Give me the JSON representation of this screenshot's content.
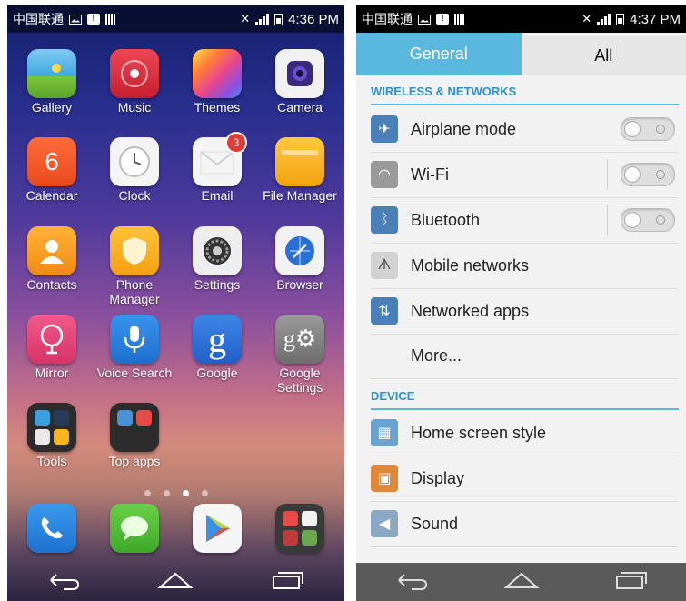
{
  "left": {
    "status": {
      "carrier": "中国联通",
      "time": "4:36 PM"
    },
    "apps": [
      {
        "label": "Gallery",
        "icon": "gallery-icon",
        "color": "#3fa7e0"
      },
      {
        "label": "Music",
        "icon": "music-icon",
        "color": "#d62b3a"
      },
      {
        "label": "Themes",
        "icon": "themes-icon",
        "color": "#e05ab0"
      },
      {
        "label": "Camera",
        "icon": "camera-icon",
        "color": "#f1f1f1"
      },
      {
        "label": "Calendar",
        "icon": "calendar-icon",
        "color": "#f05a28",
        "glyph": "6"
      },
      {
        "label": "Clock",
        "icon": "clock-icon",
        "color": "#f4f4f4"
      },
      {
        "label": "Email",
        "icon": "email-icon",
        "color": "#f4f4f4",
        "badge": "3"
      },
      {
        "label": "File Manager",
        "icon": "file-manager-icon",
        "color": "#f7b51e"
      },
      {
        "label": "Contacts",
        "icon": "contacts-icon",
        "color": "#f7a21e"
      },
      {
        "label": "Phone Manager",
        "icon": "phone-manager-icon",
        "color": "#f7b51e"
      },
      {
        "label": "Settings",
        "icon": "settings-icon",
        "color": "#f0f0f0"
      },
      {
        "label": "Browser",
        "icon": "browser-icon",
        "color": "#f2f2f2"
      },
      {
        "label": "Mirror",
        "icon": "mirror-icon",
        "color": "#e0457a"
      },
      {
        "label": "Voice Search",
        "icon": "voice-search-icon",
        "color": "#2c7fe0"
      },
      {
        "label": "Google",
        "icon": "google-icon",
        "color": "#2f6fd6",
        "glyph": "g"
      },
      {
        "label": "Google Settings",
        "icon": "google-settings-icon",
        "color": "#8a8a8a",
        "glyph": "g⚙"
      },
      {
        "label": "Tools",
        "icon": "tools-folder-icon",
        "color": "#2a2a2a"
      },
      {
        "label": "Top apps",
        "icon": "top-apps-folder-icon",
        "color": "#2a2a2a"
      }
    ],
    "dock": [
      {
        "icon": "phone-icon",
        "color": "#2c86e0"
      },
      {
        "icon": "messaging-icon",
        "color": "#4bbf3a"
      },
      {
        "icon": "play-store-icon",
        "color": "#f5f5f5"
      },
      {
        "icon": "google-apps-folder-icon",
        "color": "#3a3a3a"
      }
    ]
  },
  "right": {
    "status": {
      "carrier": "中国联通",
      "time": "4:37 PM"
    },
    "tabs": {
      "general": "General",
      "all": "All"
    },
    "sections": {
      "wireless": "WIRELESS & NETWORKS",
      "device": "DEVICE"
    },
    "rows": [
      {
        "label": "Airplane mode",
        "icon": "airplane-icon",
        "color": "#4a7fb8",
        "toggle": "off"
      },
      {
        "label": "Wi-Fi",
        "icon": "wifi-icon",
        "color": "#8c8c8c",
        "toggle": "off"
      },
      {
        "label": "Bluetooth",
        "icon": "bluetooth-icon",
        "color": "#4a7fb8",
        "toggle": "off"
      },
      {
        "label": "Mobile networks",
        "icon": "mobile-networks-icon",
        "color": "#c9c9c9"
      },
      {
        "label": "Networked apps",
        "icon": "networked-apps-icon",
        "color": "#4a7fb8"
      },
      {
        "label": "More...",
        "icon": "",
        "color": ""
      },
      {
        "label": "Home screen style",
        "icon": "home-screen-style-icon",
        "color": "#6aa3cf"
      },
      {
        "label": "Display",
        "icon": "display-icon",
        "color": "#e0873a"
      },
      {
        "label": "Sound",
        "icon": "sound-icon",
        "color": "#8aa7c4"
      }
    ]
  }
}
